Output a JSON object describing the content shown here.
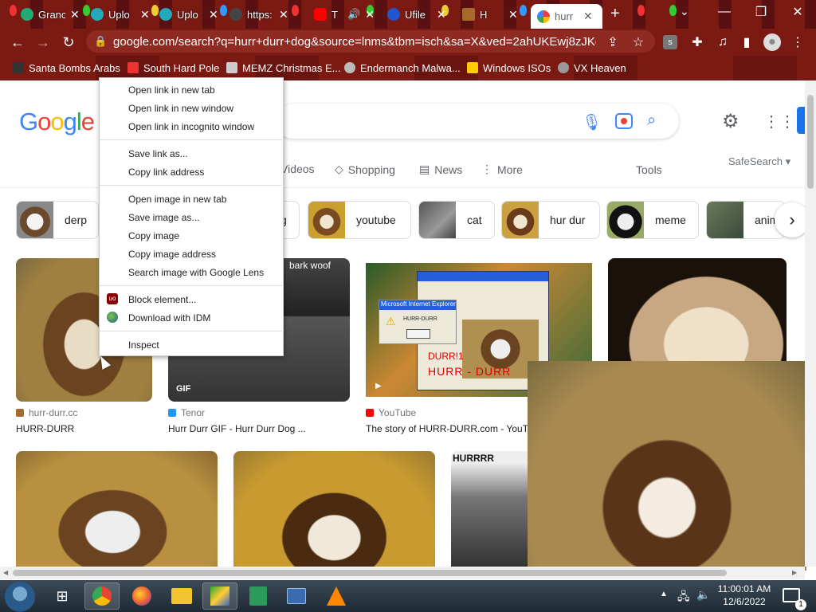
{
  "tabs": [
    {
      "label": "Granc",
      "favicon": "holiday-favicon"
    },
    {
      "label": "Uplo",
      "favicon": "upload-favicon"
    },
    {
      "label": "Uplo",
      "favicon": "upload-favicon"
    },
    {
      "label": "https:",
      "favicon": "link-favicon"
    },
    {
      "label": "T",
      "favicon": "youtube-favicon"
    },
    {
      "label": "Ufile",
      "favicon": "ufile-favicon"
    },
    {
      "label": "H",
      "favicon": "dog-favicon"
    },
    {
      "label": "hurr",
      "favicon": "google-favicon",
      "active": true
    }
  ],
  "address_bar": {
    "url": "google.com/search?q=hurr+durr+dog&source=lnms&tbm=isch&sa=X&ved=2ahUKEwj8zJKoru..."
  },
  "profile_badge": "s",
  "bookmarks": [
    "Santa Bombs Arabs",
    "South Hard Pole",
    "MEMZ Christmas E...",
    "Endermanch Malwa...",
    "Windows ISOs",
    "VX Heaven"
  ],
  "search": {
    "logo": "Google",
    "nav_tabs": [
      "Videos",
      "Shopping",
      "News",
      "More"
    ],
    "tools_label": "Tools",
    "safesearch_label": "SafeSearch"
  },
  "chips": [
    "derp",
    "g",
    "youtube",
    "cat",
    "hur dur",
    "meme",
    "anim"
  ],
  "results": [
    {
      "source": "hurr-durr.cc",
      "title": "HURR-DURR"
    },
    {
      "source": "Tenor",
      "title": "Hurr Durr GIF - Hurr Durr Dog ...",
      "badge": "GIF",
      "overlay": "bark woof"
    },
    {
      "source": "YouTube",
      "title": "The story of HURR-DURR.com - YouT",
      "dialog_title": "Microsoft Internet Explorer",
      "dialog_text": "HURR-DURR",
      "caption1": "DURR!1",
      "caption2": "HURR - DURR"
    },
    {
      "source": "",
      "title": ""
    }
  ],
  "row2": [
    {
      "overlay": "HURRRR"
    }
  ],
  "context_menu": {
    "group1": [
      "Open link in new tab",
      "Open link in new window",
      "Open link in incognito window"
    ],
    "group2": [
      "Save link as...",
      "Copy link address"
    ],
    "group3": [
      "Open image in new tab",
      "Save image as...",
      "Copy image",
      "Copy image address",
      "Search image with Google Lens"
    ],
    "group4": [
      "Block element...",
      "Download with IDM"
    ],
    "group5": [
      "Inspect"
    ]
  },
  "taskbar": {
    "time": "11:00:01 AM",
    "date": "12/6/2022",
    "notifications": "1"
  },
  "colors": {
    "chrome_red": "#7a1a12",
    "google_blue": "#4285f4",
    "google_red": "#ea4335",
    "google_yellow": "#fbbc05",
    "google_green": "#34a853"
  }
}
